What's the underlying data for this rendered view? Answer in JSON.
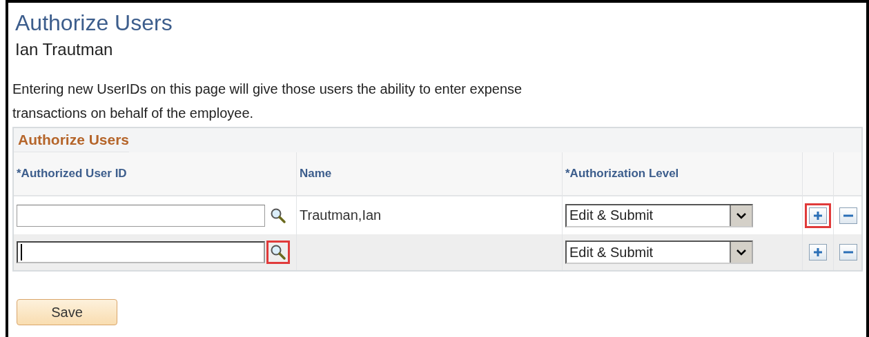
{
  "page": {
    "title": "Authorize Users",
    "employee": "Ian Trautman",
    "description": "Entering new UserIDs on this page will give those users the ability to enter expense transactions on behalf of the employee."
  },
  "grid": {
    "title": "Authorize Users",
    "columns": [
      "*Authorized User ID",
      "Name",
      "*Authorization Level"
    ],
    "rows": [
      {
        "user_id": "",
        "focused": false,
        "name": "Trautman,Ian",
        "level": "Edit & Submit",
        "search_highlighted": false,
        "add_highlighted": true
      },
      {
        "user_id": "",
        "focused": true,
        "name": "",
        "level": "Edit & Submit",
        "search_highlighted": true,
        "add_highlighted": false
      }
    ]
  },
  "buttons": [
    {
      "label": "Save"
    }
  ]
}
